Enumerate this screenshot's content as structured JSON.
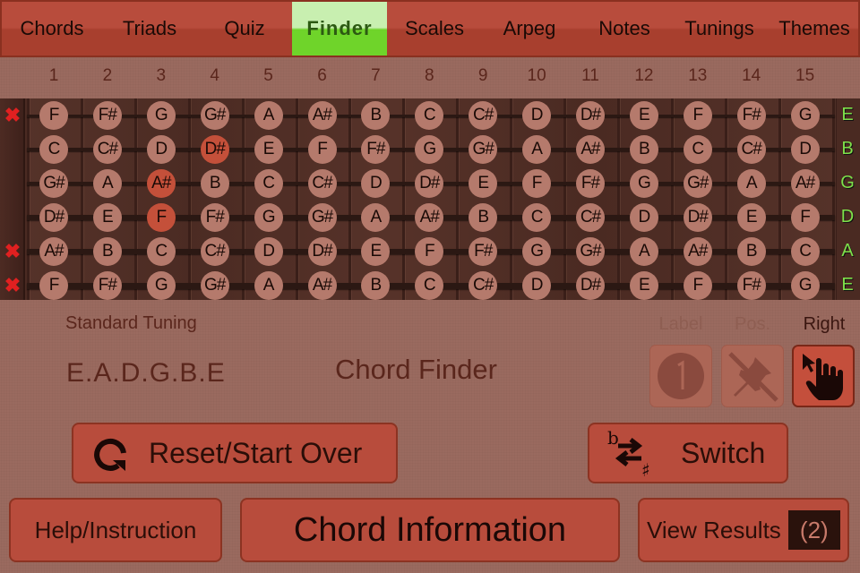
{
  "tabs": [
    {
      "label": "Chords",
      "active": false
    },
    {
      "label": "Triads",
      "active": false
    },
    {
      "label": "Quiz",
      "active": false
    },
    {
      "label": "Finder",
      "active": true
    },
    {
      "label": "Scales",
      "active": false
    },
    {
      "label": "Arpeg",
      "active": false
    },
    {
      "label": "Notes",
      "active": false
    },
    {
      "label": "Tunings",
      "active": false
    },
    {
      "label": "Themes",
      "active": false
    }
  ],
  "fret_numbers": [
    "1",
    "2",
    "3",
    "4",
    "5",
    "6",
    "7",
    "8",
    "9",
    "10",
    "11",
    "12",
    "13",
    "14",
    "15"
  ],
  "strings": [
    {
      "open": "E",
      "muted": true,
      "notes": [
        "F",
        "F#",
        "G",
        "G#",
        "A",
        "A#",
        "B",
        "C",
        "C#",
        "D",
        "D#",
        "E",
        "F",
        "F#",
        "G"
      ]
    },
    {
      "open": "B",
      "muted": false,
      "notes": [
        "C",
        "C#",
        "D",
        "D#",
        "E",
        "F",
        "F#",
        "G",
        "G#",
        "A",
        "A#",
        "B",
        "C",
        "C#",
        "D"
      ]
    },
    {
      "open": "G",
      "muted": false,
      "notes": [
        "G#",
        "A",
        "A#",
        "B",
        "C",
        "C#",
        "D",
        "D#",
        "E",
        "F",
        "F#",
        "G",
        "G#",
        "A",
        "A#"
      ]
    },
    {
      "open": "D",
      "muted": false,
      "notes": [
        "D#",
        "E",
        "F",
        "F#",
        "G",
        "G#",
        "A",
        "A#",
        "B",
        "C",
        "C#",
        "D",
        "D#",
        "E",
        "F"
      ]
    },
    {
      "open": "A",
      "muted": true,
      "notes": [
        "A#",
        "B",
        "C",
        "C#",
        "D",
        "D#",
        "E",
        "F",
        "F#",
        "G",
        "G#",
        "A",
        "A#",
        "B",
        "C"
      ]
    },
    {
      "open": "E",
      "muted": true,
      "notes": [
        "F",
        "F#",
        "G",
        "G#",
        "A",
        "A#",
        "B",
        "C",
        "C#",
        "D",
        "D#",
        "E",
        "F",
        "F#",
        "G"
      ]
    }
  ],
  "selected_notes": [
    {
      "string": 2,
      "fret": 4,
      "note": "D#"
    },
    {
      "string": 3,
      "fret": 3,
      "note": "A#"
    },
    {
      "string": 4,
      "fret": 3,
      "note": "F"
    }
  ],
  "mute_icon": "x-mark-icon",
  "info": {
    "tuning_title": "Standard Tuning",
    "tuning_value": "E.A.D.G.B.E",
    "mode_title": "Chord Finder"
  },
  "toggles": [
    {
      "label": "Label",
      "icon": "number-one-icon",
      "enabled": false
    },
    {
      "label": "Pos.",
      "icon": "pin-off-icon",
      "enabled": false
    },
    {
      "label": "Right",
      "icon": "hand-pointer-icon",
      "enabled": true
    }
  ],
  "buttons": {
    "reset": "Reset/Start Over",
    "switch": "Switch",
    "help": "Help/Instruction",
    "chord_info": "Chord Information",
    "view_results": "View Results",
    "results_count": "(2)"
  },
  "colors": {
    "background": "#9a6a5f",
    "tab_bar": "#b84c3c",
    "tab_active": "#6fd42a",
    "note_dot": "#b57a6c",
    "note_selected": "#c4503a",
    "open_string_label": "#7ee04a",
    "mute_mark": "#e02020"
  }
}
